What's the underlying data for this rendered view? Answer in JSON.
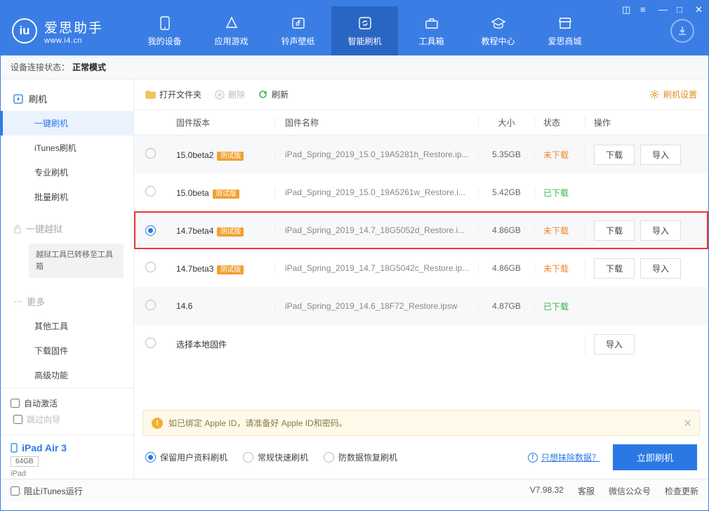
{
  "brand": {
    "name": "爱思助手",
    "url": "www.i4.cn"
  },
  "nav": [
    {
      "label": "我的设备"
    },
    {
      "label": "应用游戏"
    },
    {
      "label": "铃声壁纸"
    },
    {
      "label": "智能刷机"
    },
    {
      "label": "工具箱"
    },
    {
      "label": "教程中心"
    },
    {
      "label": "爱思商城"
    }
  ],
  "status": {
    "prefix": "设备连接状态：",
    "value": "正常模式"
  },
  "sidebar": {
    "flash": {
      "head": "刷机",
      "items": [
        "一键刷机",
        "iTunes刷机",
        "专业刷机",
        "批量刷机"
      ],
      "active": 0
    },
    "jailbreak": {
      "head": "一键越狱",
      "box": "越狱工具已转移至工具箱"
    },
    "more": {
      "head": "更多",
      "items": [
        "其他工具",
        "下载固件",
        "高级功能"
      ]
    },
    "autoactivate": "自动激活",
    "skip": "跳过向导",
    "device": {
      "name": "iPad Air 3",
      "storage": "64GB",
      "type": "iPad"
    },
    "blockitunes": "阻止iTunes运行"
  },
  "toolbar": {
    "open": "打开文件夹",
    "delete": "删除",
    "refresh": "刷新",
    "settings": "刷机设置"
  },
  "columns": {
    "ver": "固件版本",
    "name": "固件名称",
    "size": "大小",
    "status": "状态",
    "ops": "操作"
  },
  "badges": {
    "beta": "测试版"
  },
  "buttons": {
    "download": "下载",
    "import": "导入"
  },
  "statuses": {
    "not": "未下载",
    "done": "已下载"
  },
  "rows": [
    {
      "ver": "15.0beta2",
      "beta": true,
      "name": "iPad_Spring_2019_15.0_19A5281h_Restore.ip...",
      "size": "5.35GB",
      "status": "not",
      "dl": true,
      "imp": true,
      "sel": false
    },
    {
      "ver": "15.0beta",
      "beta": true,
      "name": "iPad_Spring_2019_15.0_19A5261w_Restore.i...",
      "size": "5.42GB",
      "status": "done",
      "dl": false,
      "imp": false,
      "sel": false
    },
    {
      "ver": "14.7beta4",
      "beta": true,
      "name": "iPad_Spring_2019_14.7_18G5052d_Restore.i...",
      "size": "4.86GB",
      "status": "not",
      "dl": true,
      "imp": true,
      "sel": true,
      "hl": true
    },
    {
      "ver": "14.7beta3",
      "beta": true,
      "name": "iPad_Spring_2019_14.7_18G5042c_Restore.ip...",
      "size": "4.86GB",
      "status": "not",
      "dl": true,
      "imp": true,
      "sel": false
    },
    {
      "ver": "14.6",
      "beta": false,
      "name": "iPad_Spring_2019_14.6_18F72_Restore.ipsw",
      "size": "4.87GB",
      "status": "done",
      "dl": false,
      "imp": false,
      "sel": false
    }
  ],
  "localrow": {
    "label": "选择本地固件"
  },
  "warn": "如已绑定 Apple ID，请准备好 Apple ID和密码。",
  "options": {
    "keep": "保留用户资料刷机",
    "fast": "常规快速刷机",
    "recover": "防数据恢复刷机",
    "selected": "keep"
  },
  "eraselink": "只想抹除数据？",
  "flashbtn": "立即刷机",
  "footer": {
    "version": "V7.98.32",
    "service": "客服",
    "wechat": "微信公众号",
    "update": "检查更新"
  }
}
